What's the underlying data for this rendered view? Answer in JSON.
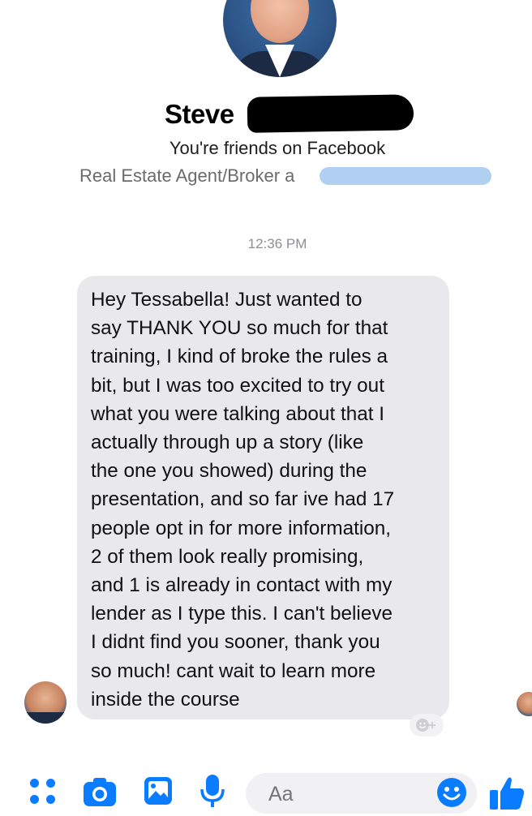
{
  "header": {
    "contact_name": "Steve",
    "friends_status": "You're friends on Facebook",
    "job_title": "Real Estate Agent/Broker a"
  },
  "conversation": {
    "timestamp": "12:36 PM",
    "messages": [
      {
        "direction": "incoming",
        "text": "Hey Tessabella! Just wanted to\nsay THANK YOU so much for that\ntraining, I kind of broke the rules a\nbit, but I was too excited to try out\nwhat you were talking about that I\nactually through up a story (like\nthe one you showed) during the\npresentation, and so far ive had 17\npeople opt in for more information,\n2 of them look really promising,\nand 1 is already in contact with my\nlender as I type this. I can't believe\nI didnt find you sooner, thank you\nso much! cant wait to learn more\ninside the course"
      }
    ],
    "react_icon": "smiley-plus-icon"
  },
  "composer": {
    "placeholder": "Aa",
    "icons": [
      "apps-icon",
      "camera-icon",
      "gallery-icon",
      "mic-icon",
      "emoji-icon",
      "like-icon"
    ]
  },
  "colors": {
    "accent": "#0a7cff",
    "bubble": "#e9e9eb",
    "redaction_blue": "#a8cbf0"
  }
}
